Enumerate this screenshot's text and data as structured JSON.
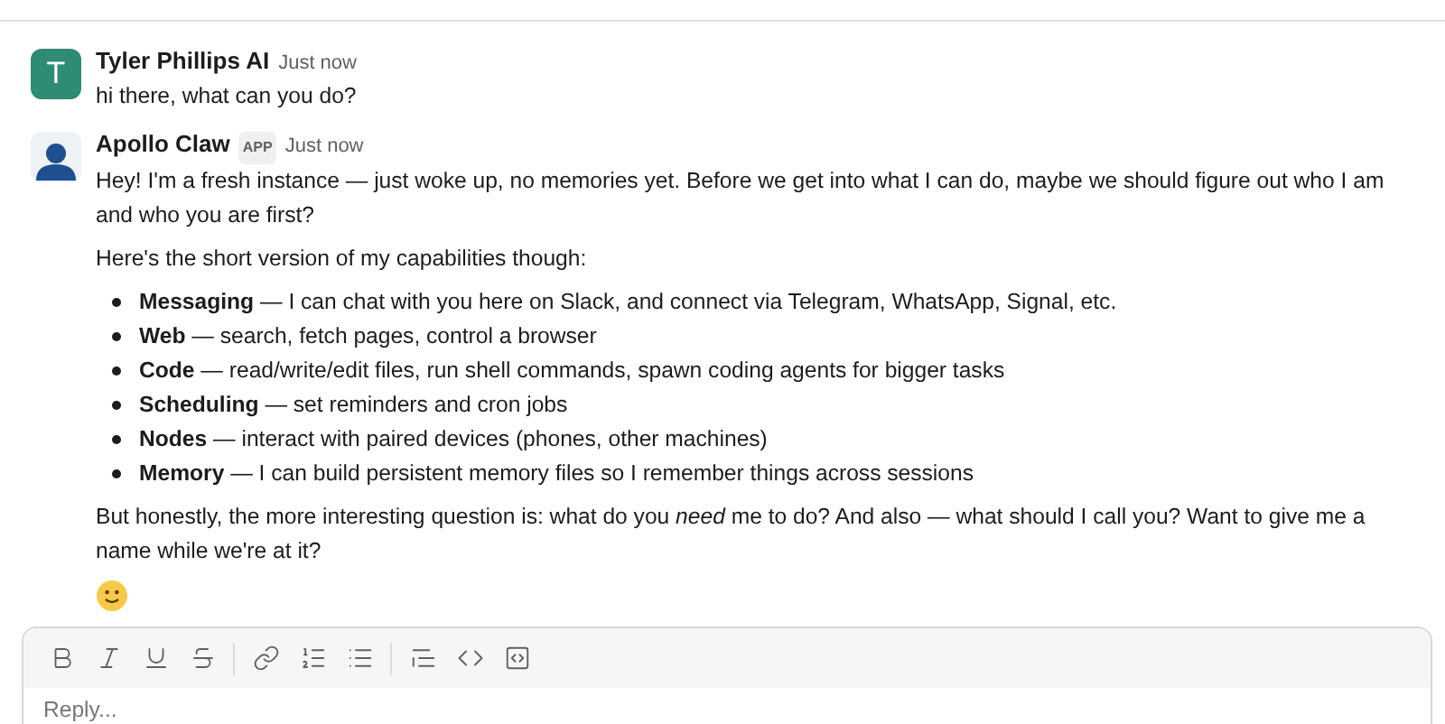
{
  "messages": [
    {
      "author": "Tyler Phillips AI",
      "avatar": {
        "kind": "letter",
        "text": "T",
        "color": "#2e8b74"
      },
      "time": "Just now",
      "paragraphs": [
        {
          "kind": "text",
          "text": "hi there, what can you do?"
        }
      ]
    },
    {
      "author": "Apollo Claw",
      "avatar": {
        "kind": "person",
        "color": "#1d4f91"
      },
      "badge": "APP",
      "time": "Just now",
      "paragraphs": [
        {
          "kind": "text",
          "text": "Hey! I'm a fresh instance — just woke up, no memories yet. Before we get into what I can do, maybe we should figure out who I am and who you are first?"
        },
        {
          "kind": "text",
          "text": "Here's the short version of my capabilities though:"
        },
        {
          "kind": "list",
          "items": [
            "**Messaging** — I can chat with you here on Slack, and connect via Telegram, WhatsApp, Signal, etc.",
            "**Web** — search, fetch pages, control a browser",
            "**Code** — read/write/edit files, run shell commands, spawn coding agents for bigger tasks",
            "**Scheduling** — set reminders and cron jobs",
            "**Nodes** — interact with paired devices (phones, other machines)",
            "**Memory** — I can build persistent memory files so I remember things across sessions"
          ]
        },
        {
          "kind": "text",
          "text": "But honestly, the more interesting question is: what do you *need* me to do? And also — what should I call you? Want to give me a name while we're at it?"
        },
        {
          "kind": "emoji"
        }
      ]
    }
  ],
  "composer": {
    "placeholder": "Reply..."
  }
}
